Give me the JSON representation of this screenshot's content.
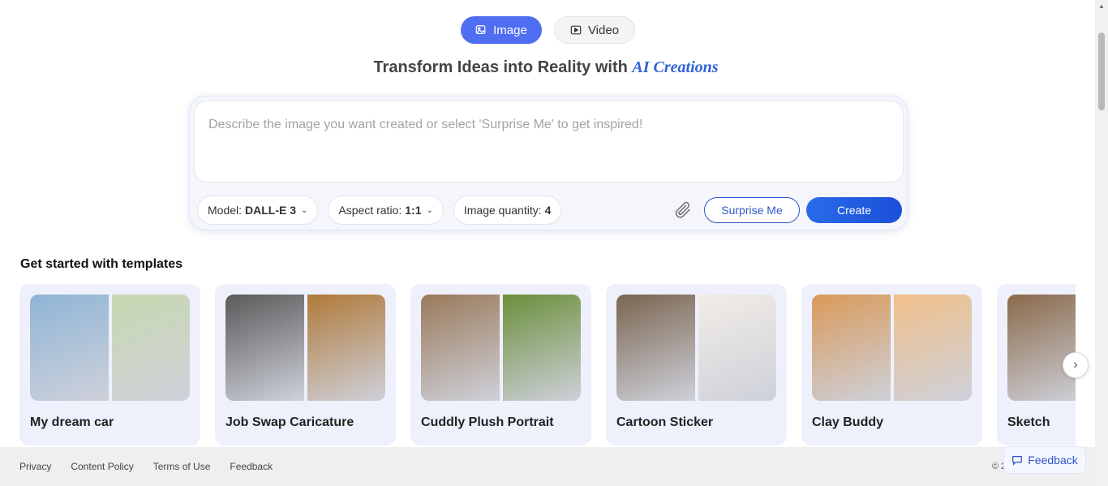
{
  "mode_toggle": {
    "image_label": "Image",
    "video_label": "Video",
    "active": "image",
    "accent_color": "#4f6ef2"
  },
  "headline": {
    "main": "Transform Ideas into Reality with",
    "accent": "AI Creations"
  },
  "prompt": {
    "placeholder": "Describe the image you want created or select 'Surprise Me' to get inspired!",
    "value": ""
  },
  "controls": {
    "model_label": "Model:",
    "model_value": "DALL-E 3",
    "aspect_label": "Aspect ratio:",
    "aspect_value": "1:1",
    "quantity_label": "Image quantity:",
    "quantity_value": "4",
    "attach_icon": "paperclip-icon",
    "surprise_label": "Surprise Me",
    "create_label": "Create"
  },
  "templates": {
    "title": "Get started with templates",
    "items": [
      {
        "label": "My dream car",
        "colors": [
          "#8fb5d6",
          "#c8d8b0"
        ]
      },
      {
        "label": "Job Swap Caricature",
        "colors": [
          "#5a5a5a",
          "#b07a3a"
        ]
      },
      {
        "label": "Cuddly Plush Portrait",
        "colors": [
          "#9a7a5a",
          "#6b8f3a"
        ]
      },
      {
        "label": "Cartoon Sticker",
        "colors": [
          "#7a6550",
          "#f1ece6"
        ]
      },
      {
        "label": "Clay Buddy",
        "colors": [
          "#d99a5a",
          "#f0c08a"
        ]
      },
      {
        "label": "Sketch",
        "colors": [
          "#8a6a4a",
          "#a0b070"
        ]
      }
    ]
  },
  "footer": {
    "links": [
      "Privacy",
      "Content Policy",
      "Terms of Use",
      "Feedback"
    ],
    "copyright": "© 2"
  },
  "feedback_button": {
    "label": "Feedback"
  }
}
